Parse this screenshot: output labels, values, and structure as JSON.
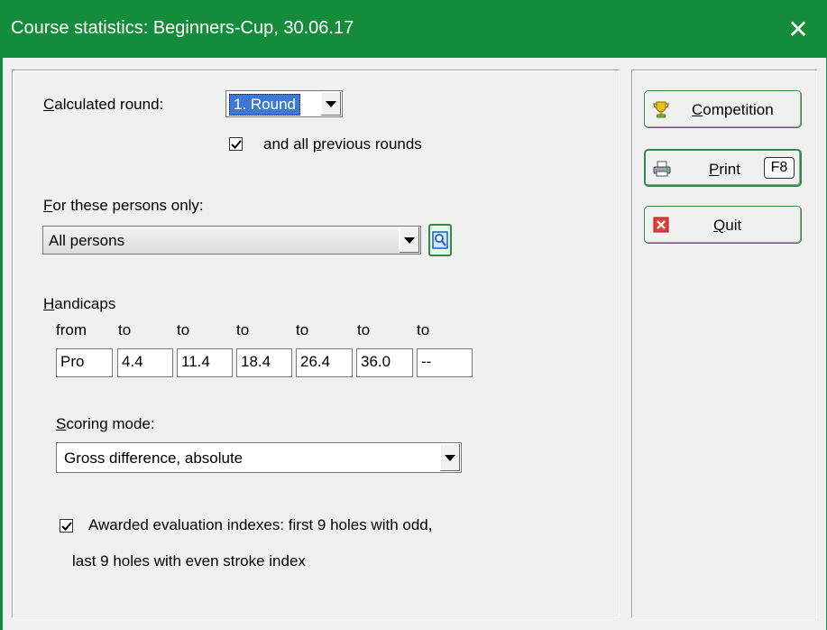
{
  "window": {
    "title": "Course statistics: Beginners-Cup, 30.06.17",
    "close_glyph": "✕"
  },
  "calculated_round": {
    "label_prefix": "C",
    "label_rest": "alculated round:",
    "selected": "1. Round",
    "all_previous": {
      "checked": true,
      "label_pre": "and all ",
      "label_u": "p",
      "label_post": "revious rounds"
    }
  },
  "persons": {
    "label_u": "F",
    "label_rest": "or these persons only:",
    "selected": "All persons"
  },
  "handicaps": {
    "label_u": "H",
    "label_rest": "andicaps",
    "headers": [
      "from",
      "to",
      "to",
      "to",
      "to",
      "to",
      "to"
    ],
    "values": [
      "Pro",
      "4.4",
      "11.4",
      "18.4",
      "26.4",
      "36.0",
      "--"
    ]
  },
  "scoring": {
    "label_u": "S",
    "label_rest": "coring mode:",
    "selected": "Gross difference, absolute"
  },
  "evaluation": {
    "checked": true,
    "line1": "Awarded evaluation indexes: first 9 holes with odd,",
    "line2": "last 9 holes with even stroke index"
  },
  "buttons": {
    "competition": {
      "label_u": "C",
      "label_rest": "ompetition",
      "icon": "trophy-icon"
    },
    "print": {
      "label_u": "P",
      "label_rest": "rint",
      "key": "F8",
      "icon": "printer-icon"
    },
    "quit": {
      "label_u": "Q",
      "label_rest": "uit",
      "icon": "quit-icon"
    }
  },
  "colors": {
    "titlebar": "#158c3c",
    "accent_border": "#2f8a48"
  }
}
